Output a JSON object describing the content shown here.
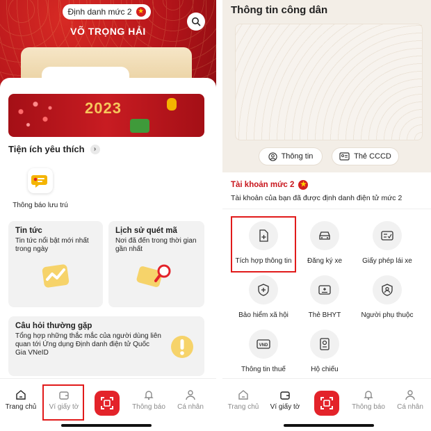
{
  "left": {
    "level_badge": "Định danh mức 2",
    "user_name": "VÕ TRỌNG HẢI",
    "banner": {
      "year": "2023"
    },
    "favorites_title": "Tiện ích yêu thích",
    "favorite_item": "Thông báo lưu trú",
    "tiles": [
      {
        "title": "Tin tức",
        "desc": "Tin tức nổi bật mới nhất trong ngày"
      },
      {
        "title": "Lịch sử quét mã",
        "desc": "Nơi đã đến trong thời gian gần nhất"
      },
      {
        "title": "Câu hỏi thường gặp",
        "desc": "Tổng hợp những thắc mắc của người dùng liên quan tới Ứng dụng Định danh điện tử Quốc Gia VNeID"
      }
    ],
    "nav": {
      "home": "Trang chủ",
      "wallet": "Ví giấy tờ",
      "notifications": "Thông báo",
      "profile": "Cá nhân"
    }
  },
  "right": {
    "title": "Thông tin công dân",
    "pill_info": "Thông tin",
    "pill_cccd": "Thẻ CCCD",
    "account_title": "Tài khoản mức 2",
    "account_desc": "Tài khoản của bạn đã được định danh điện tử mức 2",
    "features": [
      {
        "label": "Tích hợp thông tin",
        "icon": "document-add-icon"
      },
      {
        "label": "Đăng ký xe",
        "icon": "car-icon"
      },
      {
        "label": "Giấy phép lái xe",
        "icon": "license-card-icon"
      },
      {
        "label": "Bảo hiểm xã hội",
        "icon": "shield-plus-icon"
      },
      {
        "label": "Thẻ BHYT",
        "icon": "health-card-icon"
      },
      {
        "label": "Người phụ thuộc",
        "icon": "person-shield-icon"
      },
      {
        "label": "Thông tin thuế",
        "icon": "vnd-tax-icon"
      },
      {
        "label": "Hộ chiếu",
        "icon": "passport-icon"
      }
    ],
    "nav": {
      "home": "Trang chủ",
      "wallet": "Ví giấy tờ",
      "notifications": "Thông báo",
      "profile": "Cá nhân"
    }
  },
  "colors": {
    "primary_red": "#e3232a",
    "highlight_box": "#e11a1a",
    "account_red": "#c8161d"
  }
}
